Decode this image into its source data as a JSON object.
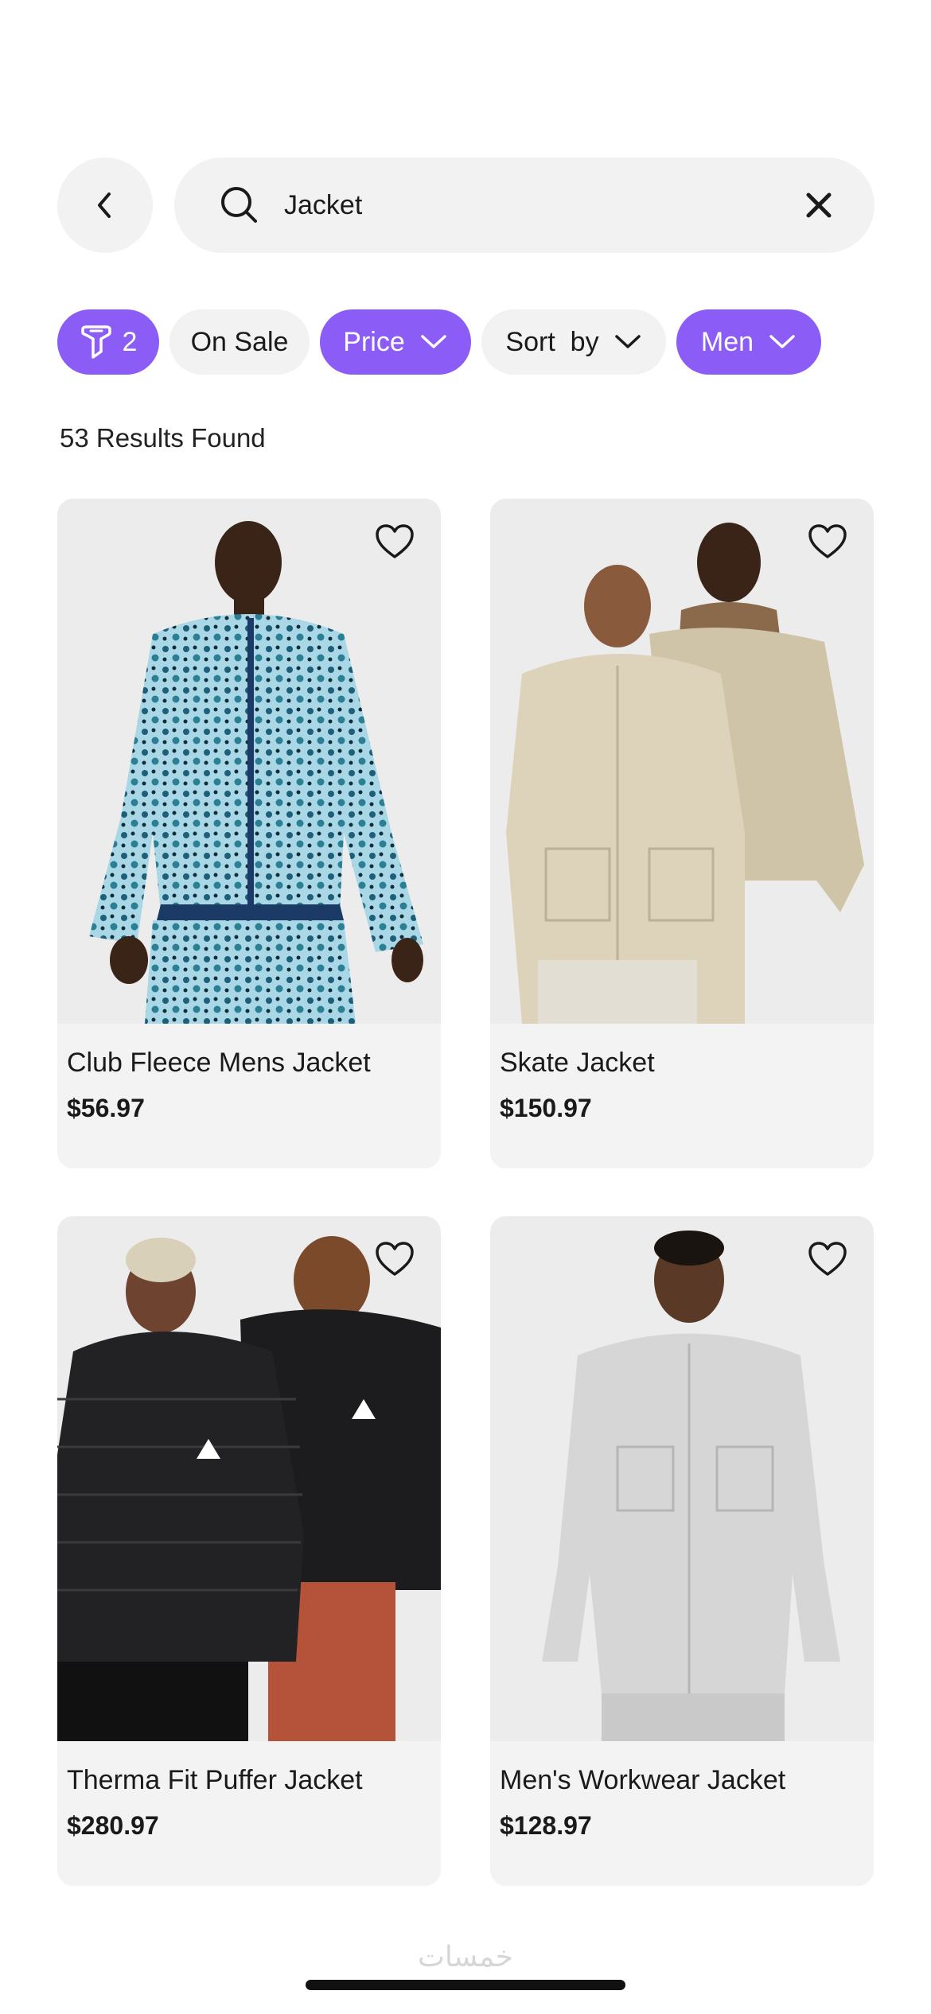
{
  "search": {
    "query": "Jacket",
    "icons": {
      "back": "chevron-left-icon",
      "search": "search-icon",
      "clear": "close-icon"
    }
  },
  "filters": {
    "active_count": "2",
    "chips": [
      {
        "label": "On Sale",
        "active": false
      },
      {
        "label": "Price",
        "active": true
      },
      {
        "label": "Sort  by",
        "active": false
      },
      {
        "label": "Men",
        "active": true
      }
    ],
    "accent_color": "#8b5cf6"
  },
  "results": {
    "label": "53 Results Found"
  },
  "products": [
    {
      "name": "Club Fleece Mens Jacket",
      "price": "$56.97"
    },
    {
      "name": "Skate Jacket",
      "price": "$150.97"
    },
    {
      "name": "Therma Fit Puffer Jacket",
      "price": "$280.97"
    },
    {
      "name": "Men's Workwear Jacket",
      "price": "$128.97"
    }
  ],
  "watermark": "خمسات"
}
